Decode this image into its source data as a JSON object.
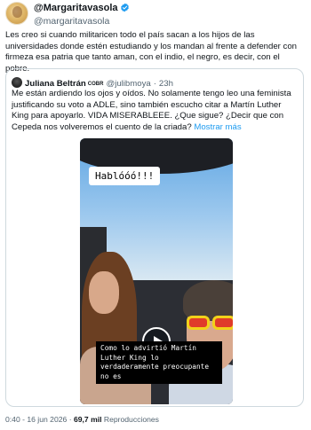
{
  "author": {
    "display_name": "@Margaritavasola",
    "handle": "@margaritavasola",
    "avatar_icon": "avatar-photo"
  },
  "tweet": {
    "text": "Les creo si cuando militaricen todo el país sacan a los hijos de las universidades donde estén estudiando y los mandan al frente a defender con firmeza esa patria que tanto aman, con el indio, el negro, es decir, con el pobre."
  },
  "quoted": {
    "name": "Juliana Beltrán",
    "badge": "COBR",
    "handle": "@julibmoya",
    "separator": "·",
    "time": "23h",
    "text": "Me están ardiendo los ojos y oídos. No solamente tengo leo una feminista justificando su voto a ADLE, sino también escucho citar a Martín Luther King para apoyarlo. VIDA MISERABLEEE. ¿Que sigue? ¿Decir que con Cepeda  nos volveremos el cuento de la criada?",
    "show_more": "Mostrar más",
    "video": {
      "caption_top": "Hablóóó!!!",
      "caption_bottom": "Como lo advirtió Martín Luther King lo verdaderamente preocupante no es"
    }
  },
  "footer": {
    "time": "0:40 - 16 jun 2026",
    "separator": "·",
    "views_count": "69,7 mil",
    "views_label": "Reproducciones"
  },
  "colors": {
    "verified": "#1d9bf0",
    "link": "#1d9bf0",
    "muted": "#536471",
    "border": "#cfd9de"
  }
}
